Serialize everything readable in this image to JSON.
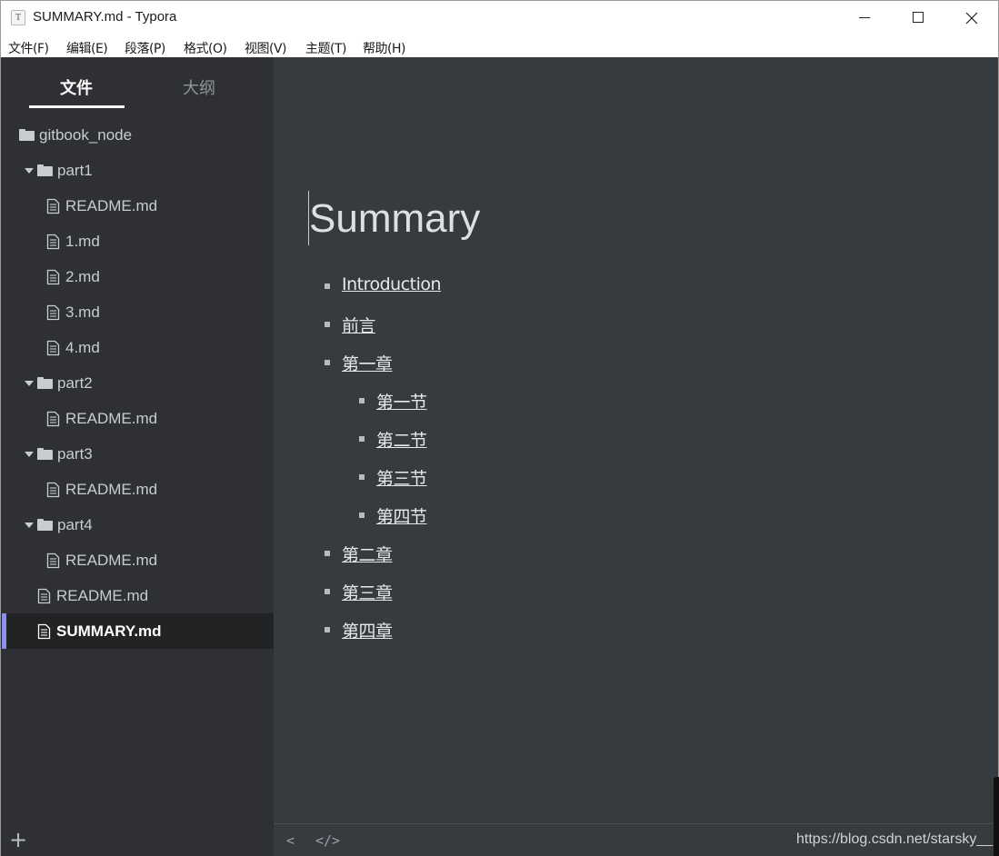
{
  "window": {
    "title": "SUMMARY.md - Typora",
    "app_icon_letter": "T"
  },
  "menubar": {
    "items": [
      "文件(F)",
      "编辑(E)",
      "段落(P)",
      "格式(O)",
      "视图(V)",
      "主题(T)",
      "帮助(H)"
    ]
  },
  "sidebar": {
    "tabs": [
      "文件",
      "大纲"
    ],
    "active_tab": "文件",
    "tree": [
      {
        "type": "folder",
        "label": "gitbook_node",
        "depth": 0,
        "expanded": true
      },
      {
        "type": "folder",
        "label": "part1",
        "depth": 1,
        "expanded": true
      },
      {
        "type": "file",
        "label": "README.md",
        "depth": 2
      },
      {
        "type": "file",
        "label": "1.md",
        "depth": 2
      },
      {
        "type": "file",
        "label": "2.md",
        "depth": 2
      },
      {
        "type": "file",
        "label": "3.md",
        "depth": 2
      },
      {
        "type": "file",
        "label": "4.md",
        "depth": 2
      },
      {
        "type": "folder",
        "label": "part2",
        "depth": 1,
        "expanded": true
      },
      {
        "type": "file",
        "label": "README.md",
        "depth": 2
      },
      {
        "type": "folder",
        "label": "part3",
        "depth": 1,
        "expanded": true
      },
      {
        "type": "file",
        "label": "README.md",
        "depth": 2
      },
      {
        "type": "folder",
        "label": "part4",
        "depth": 1,
        "expanded": true
      },
      {
        "type": "file",
        "label": "README.md",
        "depth": 2
      },
      {
        "type": "file",
        "label": "README.md",
        "depth": 1
      },
      {
        "type": "file",
        "label": "SUMMARY.md",
        "depth": 1,
        "active": true
      }
    ],
    "footer_icon": "plus-icon"
  },
  "document": {
    "title": "Summary",
    "items": [
      {
        "label": "Introduction",
        "level": 1
      },
      {
        "label": "前言",
        "level": 1
      },
      {
        "label": "第一章",
        "level": 1
      },
      {
        "label": "第一节",
        "level": 2
      },
      {
        "label": "第二节",
        "level": 2
      },
      {
        "label": "第三节",
        "level": 2
      },
      {
        "label": "第四节",
        "level": 2
      },
      {
        "label": "第二章",
        "level": 1
      },
      {
        "label": "第三章",
        "level": 1
      },
      {
        "label": "第四章",
        "level": 1
      }
    ]
  },
  "statusbar": {
    "left_icons": [
      "chevron-left-icon",
      "code-icon"
    ],
    "watermark": "https://blog.csdn.net/starsky__"
  },
  "colors": {
    "sidebar_bg": "#2e3033",
    "editor_bg": "#363b40",
    "active_accent": "#8b8ff0",
    "text": "#c9ccd0"
  }
}
